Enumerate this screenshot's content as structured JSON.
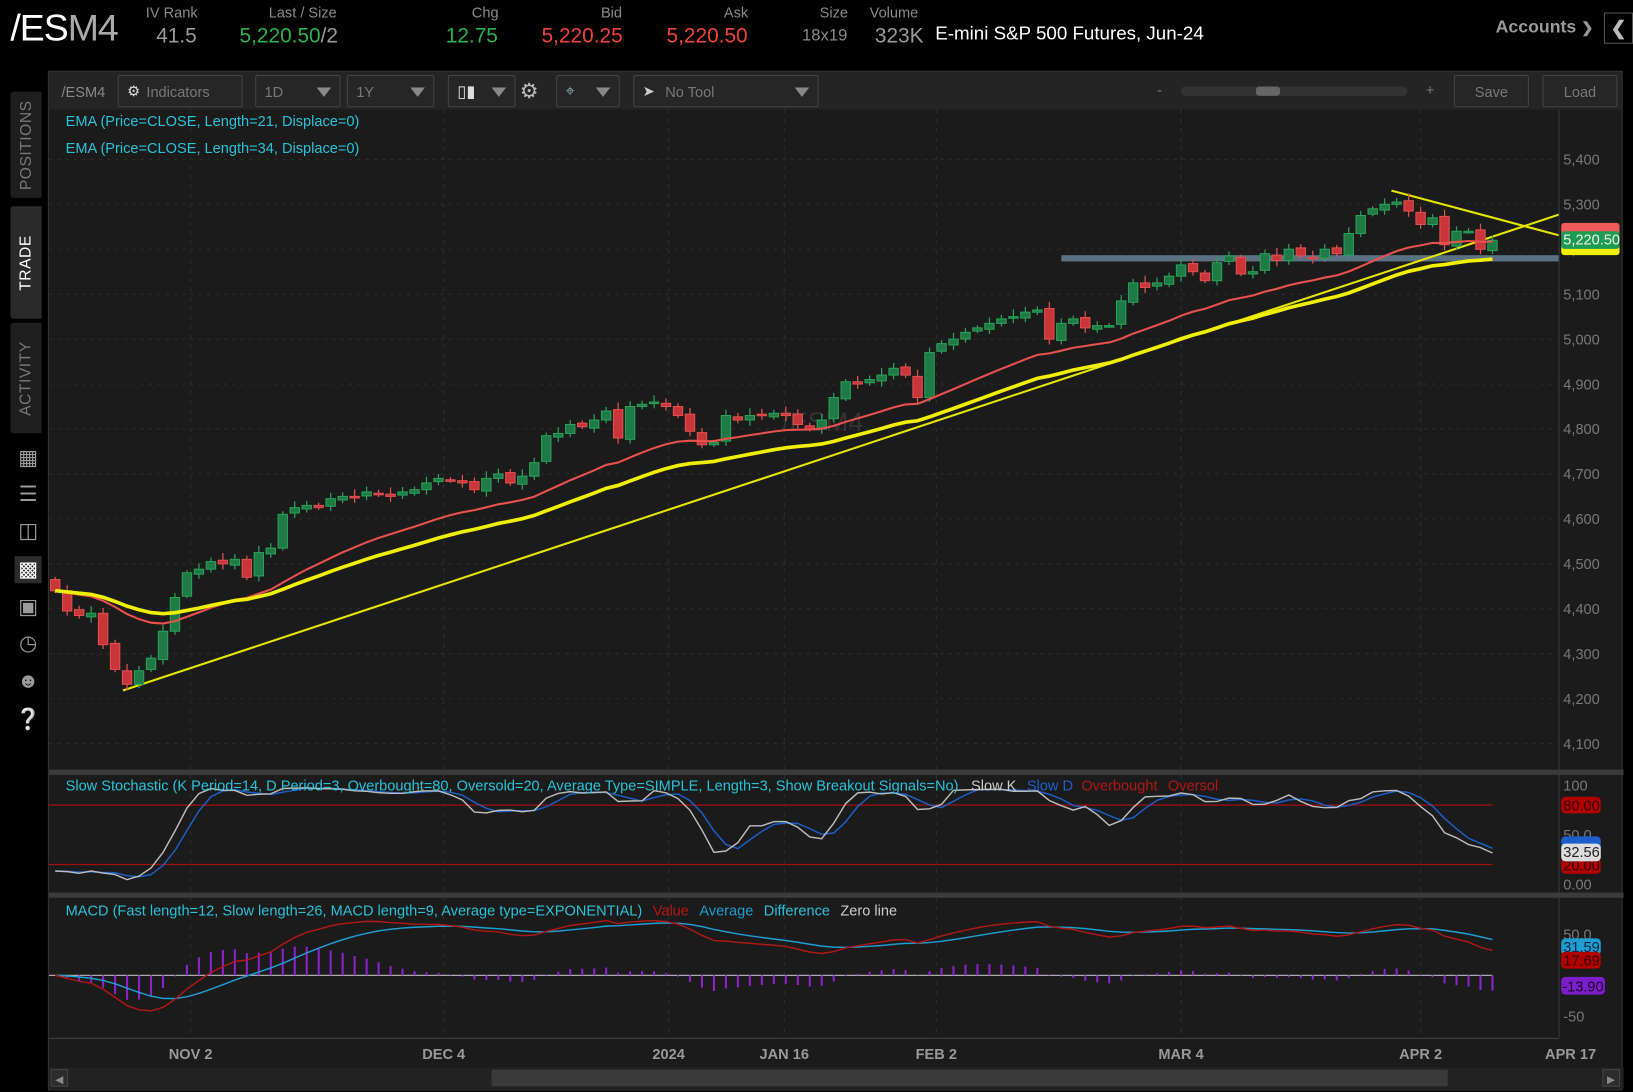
{
  "header": {
    "symbol_main": "/ES",
    "symbol_suffix": "M4",
    "iv_rank_label": "IV Rank",
    "iv_rank": "41.5",
    "last_label": "Last / Size",
    "last": "5,220.50",
    "last_size": "/2",
    "chg_label": "Chg",
    "chg": "12.75",
    "bid_label": "Bid",
    "bid": "5,220.25",
    "ask_label": "Ask",
    "ask": "5,220.50",
    "size_label": "Size",
    "size": "18x19",
    "volume_label": "Volume",
    "volume": "323K",
    "description": "E-mini S&P 500 Futures, Jun-24",
    "accounts_label": "Accounts"
  },
  "sidebar": {
    "tabs": [
      "POSITIONS",
      "TRADE",
      "ACTIVITY"
    ],
    "active_tab": "TRADE",
    "icons": [
      "calculator-icon",
      "list-icon",
      "tv-icon",
      "chart-icon",
      "grid-icon",
      "clock-icon",
      "people-icon",
      "help-icon"
    ]
  },
  "toolbar": {
    "symbol": "/ESM4",
    "indicators": "Indicators",
    "aggregation": "1D",
    "range": "1Y",
    "drawing_tool": "No Tool",
    "zoom_minus": "-",
    "zoom_plus": "+",
    "zoom_level": 0.33,
    "save": "Save",
    "load": "Load"
  },
  "studies": {
    "ema1": "EMA (Price=CLOSE, Length=21, Displace=0)",
    "ema2": "EMA (Price=CLOSE, Length=34, Displace=0)",
    "stoch": "Slow Stochastic (K Period=14, D Period=3, Overbought=80, Oversold=20, Average Type=SIMPLE, Length=3, Show Breakout Signals=No)",
    "stoch_legend": [
      "Slow K",
      "Slow D",
      "Overbought",
      "Oversol"
    ],
    "macd": "MACD (Fast length=12, Slow length=26, MACD length=9, Average type=EXPONENTIAL)",
    "macd_legend": [
      "Value",
      "Average",
      "Difference",
      "Zero line"
    ]
  },
  "watermark": "/ESM4",
  "colors": {
    "up": "#1f7a45",
    "down": "#c8363a",
    "ema21": "#e8514f",
    "ema34": "#f0f000",
    "trendline": "#e6e600",
    "support_band": "#6f8fa6",
    "slow_k": "#bbbbbb",
    "slow_d": "#1d5fc8",
    "macd_value": "#b01717",
    "macd_avg": "#1f9ed0",
    "macd_diff": "#8a23c8"
  },
  "tags": {
    "price_last": "5,220.50",
    "stoch_k": "32.56",
    "stoch_ob": "80.00",
    "stoch_os": "20.00",
    "macd_avg": "31.59",
    "macd_value": "17.69",
    "macd_diff": "-13.90"
  },
  "chart_data": {
    "type": "candlestick",
    "x_labels": [
      "NOV 2",
      "DEC 4",
      "2024",
      "JAN 16",
      "FEB 2",
      "MAR 4",
      "APR 2",
      "APR 17"
    ],
    "y_ticks": [
      "5,400",
      "5,300",
      "5,200",
      "5,100",
      "5,000",
      "4,900",
      "4,800",
      "4,700",
      "4,600",
      "4,500",
      "4,400",
      "4,300",
      "4,200",
      "4,100"
    ],
    "ylim": [
      4070,
      5430
    ],
    "stoch_ticks": [
      "100",
      "50.0",
      "0.00"
    ],
    "macd_ticks": [
      "50.0",
      "-50"
    ],
    "support_level": 5175,
    "trendline_up": [
      [
        4222,
        "Oct 24"
      ],
      [
        5280,
        "Apr 17"
      ]
    ],
    "trendline_down": [
      [
        5330,
        "Mar 28"
      ],
      [
        5230,
        "Apr 17"
      ]
    ],
    "close": [
      4440,
      4395,
      4385,
      4390,
      4320,
      4265,
      4232,
      4262,
      4290,
      4350,
      4425,
      4480,
      4488,
      4505,
      4500,
      4510,
      4470,
      4525,
      4535,
      4610,
      4625,
      4630,
      4625,
      4645,
      4650,
      4648,
      4660,
      4655,
      4650,
      4660,
      4665,
      4680,
      4690,
      4685,
      4680,
      4665,
      4690,
      4700,
      4680,
      4695,
      4725,
      4785,
      4790,
      4810,
      4805,
      4820,
      4840,
      4780,
      4850,
      4855,
      4860,
      4850,
      4830,
      4795,
      4765,
      4770,
      4830,
      4820,
      4830,
      4830,
      4835,
      4830,
      4810,
      4800,
      4820,
      4870,
      4905,
      4900,
      4910,
      4920,
      4935,
      4920,
      4870,
      4970,
      4990,
      5000,
      5015,
      5025,
      5035,
      5045,
      5050,
      5060,
      5065,
      5000,
      5035,
      5045,
      5025,
      5030,
      5030,
      5085,
      5125,
      5115,
      5125,
      5140,
      5165,
      5150,
      5130,
      5170,
      5185,
      5145,
      5150,
      5190,
      5175,
      5200,
      5185,
      5180,
      5200,
      5190,
      5235,
      5275,
      5290,
      5300,
      5305,
      5285,
      5255,
      5270,
      5210,
      5240,
      5240,
      5200,
      5220
    ]
  }
}
